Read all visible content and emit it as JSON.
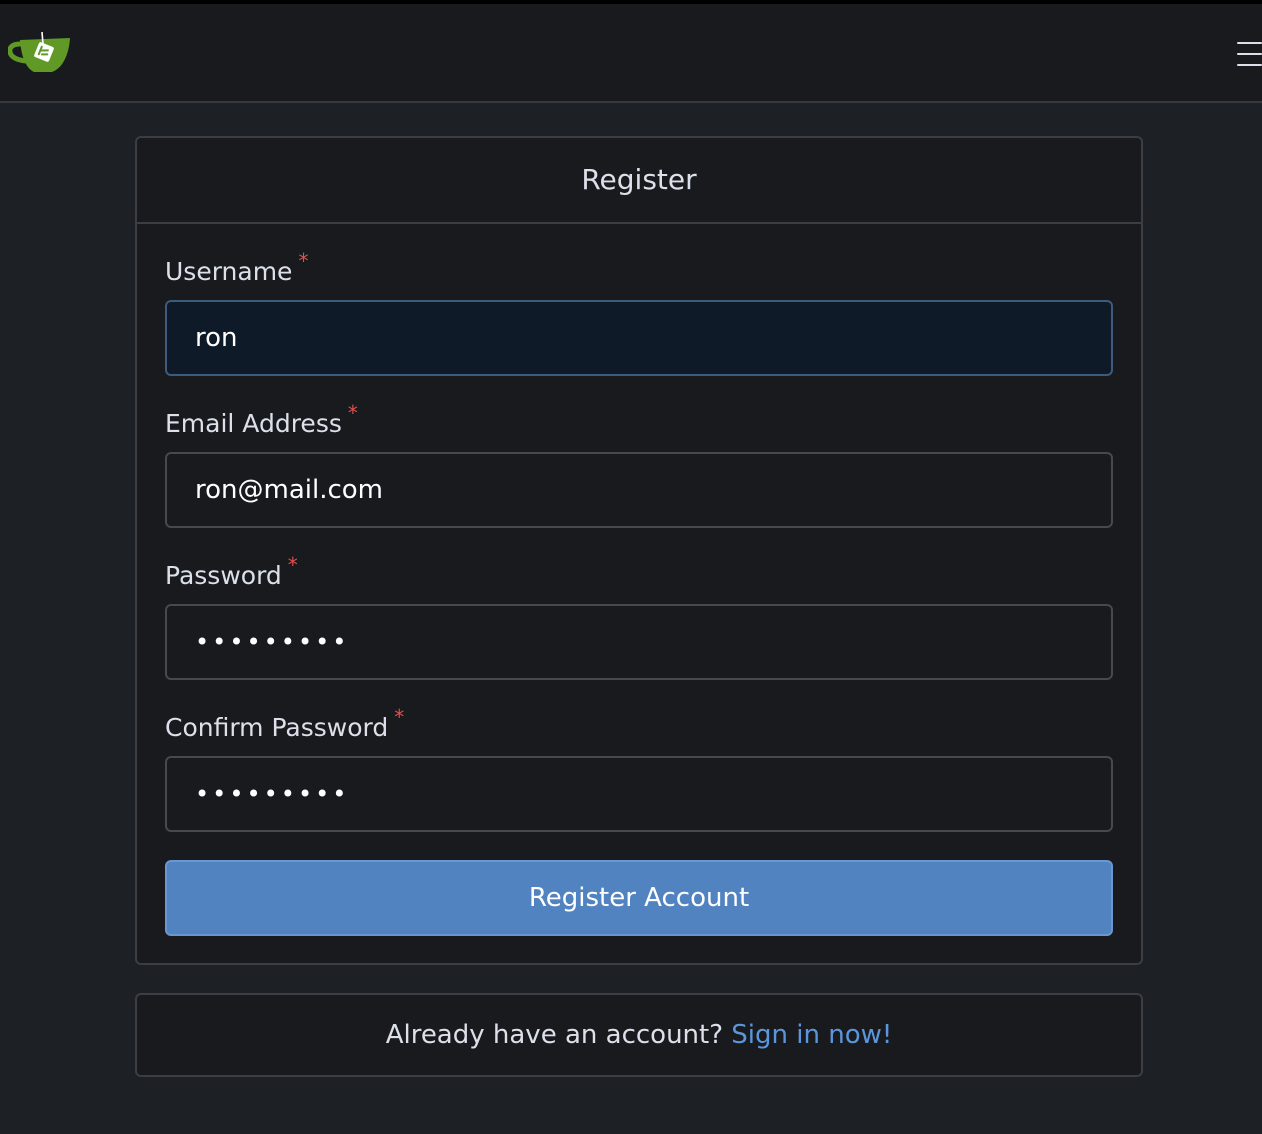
{
  "navbar": {
    "logo_icon": "gitea-teacup-logo",
    "menu_icon": "hamburger-menu-icon",
    "brand_color": "#609926"
  },
  "register_form": {
    "title": "Register",
    "required_marker": "*",
    "fields": [
      {
        "label": "Username",
        "value": "ron",
        "type": "text",
        "focused": true
      },
      {
        "label": "Email Address",
        "value": "ron@mail.com",
        "type": "email"
      },
      {
        "label": "Password",
        "value": "•••••••••",
        "type": "password"
      },
      {
        "label": "Confirm Password",
        "value": "•••••••••",
        "type": "password"
      }
    ],
    "submit_label": "Register Account",
    "submit_color": "#5283c1"
  },
  "signin": {
    "prompt": "Already have an account?",
    "link_label": "Sign in now!",
    "link_color": "#5b95db"
  }
}
